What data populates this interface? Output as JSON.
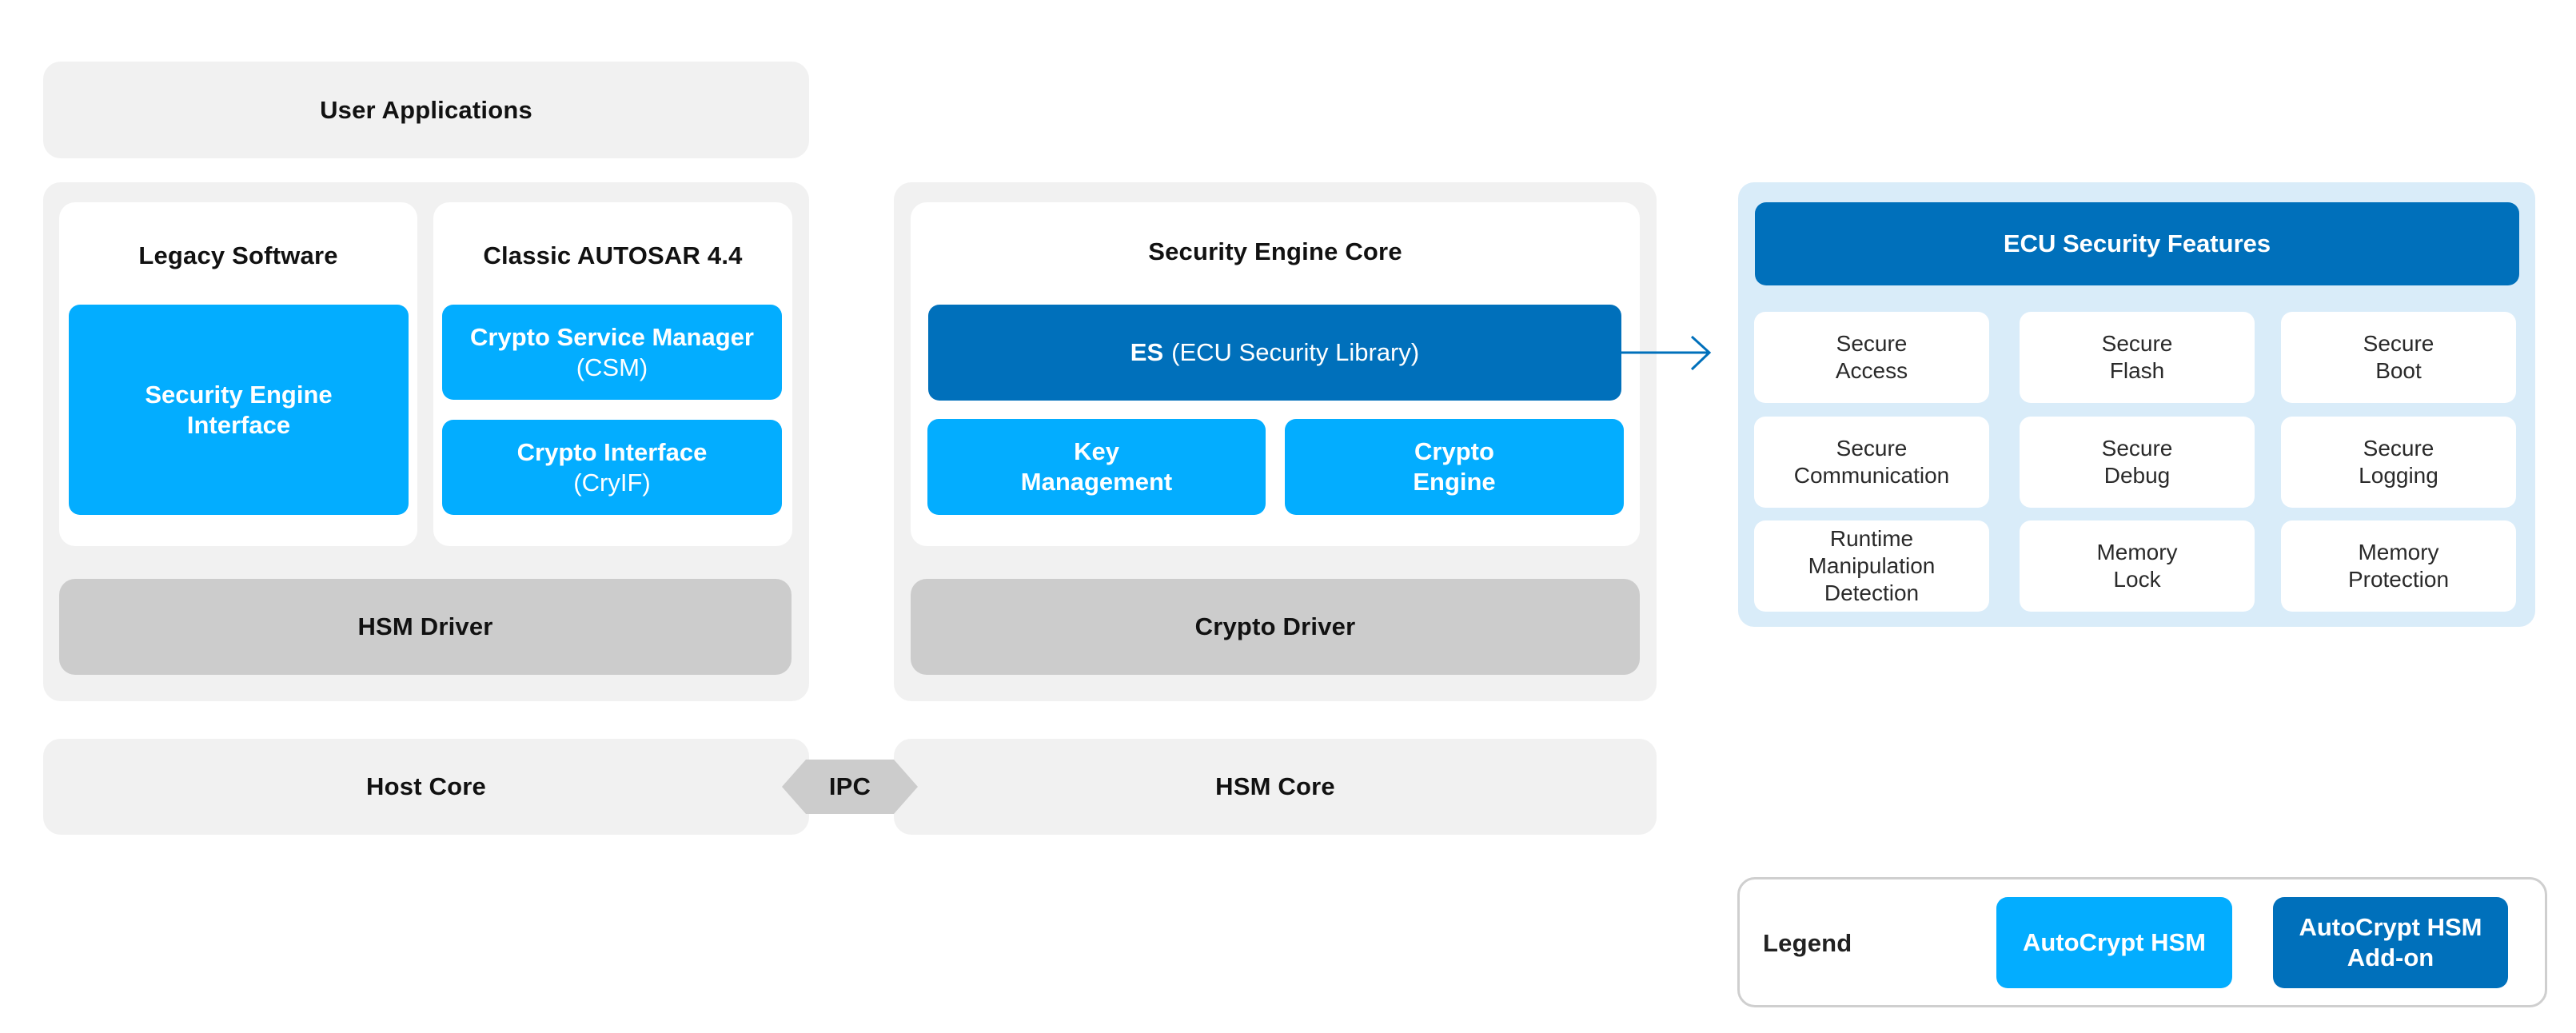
{
  "colors": {
    "autocrypt_hsm": "#03adff",
    "autocrypt_hsm_addon": "#0070bb",
    "layer_background": "#f1f1f1",
    "driver_background": "#cccccc",
    "features_panel": "#d9ecf9"
  },
  "user_applications": {
    "label": "User Applications"
  },
  "host_stack": {
    "legacy": {
      "title": "Legacy Software",
      "component": {
        "line1": "Security Engine",
        "line2": "Interface"
      }
    },
    "autosar": {
      "title": "Classic AUTOSAR 4.4",
      "csm": {
        "name": "Crypto Service Manager",
        "abbr": "(CSM)"
      },
      "cryif": {
        "name": "Crypto Interface",
        "abbr": "(CryIF)"
      }
    },
    "driver": "HSM Driver"
  },
  "hsm_stack": {
    "core_title": "Security Engine Core",
    "es_library": {
      "abbr": "ES",
      "name": "(ECU Security Library)"
    },
    "key_management": {
      "line1": "Key",
      "line2": "Management"
    },
    "crypto_engine": {
      "line1": "Crypto",
      "line2": "Engine"
    },
    "driver": "Crypto Driver"
  },
  "cores": {
    "host": "Host Core",
    "ipc": "IPC",
    "hsm": "HSM Core"
  },
  "ecu_features": {
    "title": "ECU Security Features",
    "items": [
      {
        "line1": "Secure",
        "line2": "Access"
      },
      {
        "line1": "Secure",
        "line2": "Flash"
      },
      {
        "line1": "Secure",
        "line2": "Boot"
      },
      {
        "line1": "Secure",
        "line2": "Communication"
      },
      {
        "line1": "Secure",
        "line2": "Debug"
      },
      {
        "line1": "Secure",
        "line2": "Logging"
      },
      {
        "line1": "Runtime",
        "line2": "Manipulation",
        "line3": "Detection"
      },
      {
        "line1": "Memory",
        "line2": "Lock"
      },
      {
        "line1": "Memory",
        "line2": "Protection"
      }
    ]
  },
  "legend": {
    "title": "Legend",
    "items": [
      {
        "line1": "AutoCrypt HSM"
      },
      {
        "line1": "AutoCrypt HSM",
        "line2": "Add-on"
      }
    ]
  }
}
